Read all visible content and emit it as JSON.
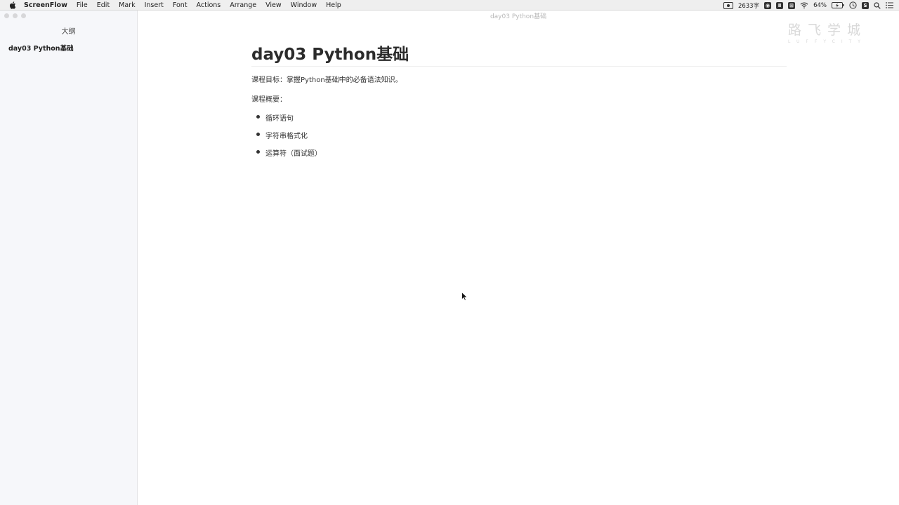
{
  "menubar": {
    "app_name": "ScreenFlow",
    "items": [
      "File",
      "Edit",
      "Mark",
      "Insert",
      "Font",
      "Actions",
      "Arrange",
      "View",
      "Window",
      "Help"
    ],
    "status": {
      "word_count": "2633字",
      "battery": "64%",
      "icons": [
        "screen-record-icon",
        "word-count",
        "camera-icon",
        "tool-icon",
        "grid-icon",
        "wifi-icon",
        "battery-icon",
        "clock-icon",
        "app-icon",
        "search-icon",
        "list-icon"
      ]
    }
  },
  "window": {
    "title": "day03 Python基础"
  },
  "sidebar": {
    "title": "大纲",
    "items": [
      "day03 Python基础"
    ]
  },
  "watermark": {
    "cn": "路飞学城",
    "en": "LUFFYCITY"
  },
  "document": {
    "heading": "day03 Python基础",
    "goal": "课程目标：掌握Python基础中的必备语法知识。",
    "overview_label": "课程概要：",
    "bullets": [
      "循环语句",
      "字符串格式化",
      "运算符（面试题）"
    ]
  }
}
